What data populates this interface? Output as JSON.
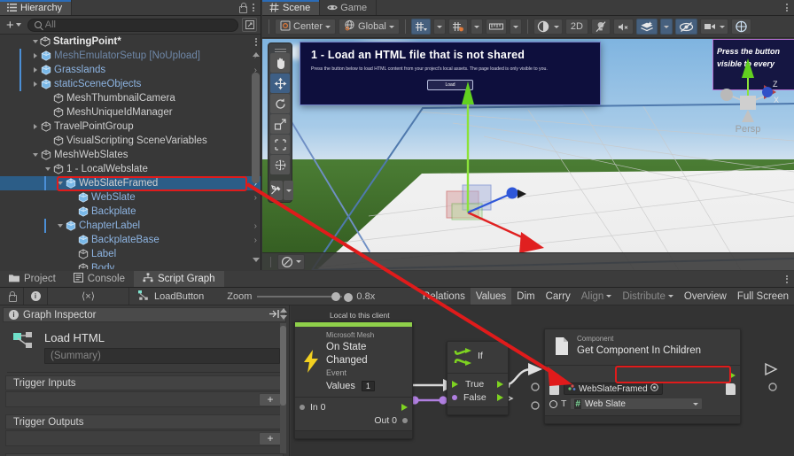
{
  "hierarchy": {
    "tab_label": "Hierarchy",
    "search_placeholder": "All",
    "add_label": "+",
    "scene_name": "StartingPoint*",
    "items": [
      {
        "label": "MeshEmulatorSetup [NoUpload]",
        "indent": 1,
        "twisty": "right",
        "icon": "prefab-cube",
        "color": "dim",
        "chev": true,
        "prefab": true
      },
      {
        "label": "Grasslands",
        "indent": 1,
        "twisty": "right",
        "icon": "prefab-cube",
        "color": "blue",
        "chev": true,
        "prefab": true
      },
      {
        "label": "staticSceneObjects",
        "indent": 1,
        "twisty": "right",
        "icon": "prefab-cube",
        "color": "blue",
        "chev": true,
        "prefab": true
      },
      {
        "label": "MeshThumbnailCamera",
        "indent": 2,
        "twisty": "none",
        "icon": "gameobject",
        "color": "plain",
        "chev": false,
        "prefab": false
      },
      {
        "label": "MeshUniqueIdManager",
        "indent": 2,
        "twisty": "none",
        "icon": "gameobject",
        "color": "plain",
        "chev": false,
        "prefab": false
      },
      {
        "label": "TravelPointGroup",
        "indent": 1,
        "twisty": "right",
        "icon": "gameobject",
        "color": "plain",
        "chev": false,
        "prefab": false
      },
      {
        "label": "VisualScripting SceneVariables",
        "indent": 2,
        "twisty": "none",
        "icon": "gameobject",
        "color": "plain",
        "chev": false,
        "prefab": false
      },
      {
        "label": "MeshWebSlates",
        "indent": 1,
        "twisty": "down",
        "icon": "gameobject",
        "color": "plain",
        "chev": false,
        "prefab": false
      },
      {
        "label": "1 - LocalWebslate",
        "indent": 2,
        "twisty": "down",
        "icon": "gameobject",
        "color": "plain",
        "chev": false,
        "prefab": false
      },
      {
        "label": "WebSlateFramed",
        "indent": 3,
        "twisty": "down",
        "icon": "prefab-cube",
        "color": "plain",
        "chev": true,
        "prefab": true,
        "selected": true,
        "highlight": true
      },
      {
        "label": "WebSlate",
        "indent": 4,
        "twisty": "none",
        "icon": "prefab-cube",
        "color": "blue",
        "chev": true,
        "prefab": false
      },
      {
        "label": "Backplate",
        "indent": 4,
        "twisty": "none",
        "icon": "prefab-cube-variant",
        "color": "blue",
        "chev": false,
        "prefab": false
      },
      {
        "label": "ChapterLabel",
        "indent": 3,
        "twisty": "down",
        "icon": "prefab-cube",
        "color": "blue",
        "chev": true,
        "prefab": true
      },
      {
        "label": "BackplateBase",
        "indent": 4,
        "twisty": "none",
        "icon": "prefab-cube",
        "color": "blue",
        "chev": true,
        "prefab": false
      },
      {
        "label": "Label",
        "indent": 4,
        "twisty": "none",
        "icon": "gameobject",
        "color": "blue",
        "chev": false,
        "prefab": false
      },
      {
        "label": "Body",
        "indent": 4,
        "twisty": "none",
        "icon": "gameobject",
        "color": "blue",
        "chev": false,
        "prefab": false
      }
    ]
  },
  "scene": {
    "tabs": [
      {
        "label": "Scene",
        "icon": "grid-icon",
        "active": true
      },
      {
        "label": "Game",
        "icon": "gamepad-icon",
        "active": false
      }
    ],
    "toolbar": {
      "pivot_mode": "Center",
      "handle_space": "Global",
      "twod_label": "2D",
      "grid_icon": "grid-snap-icon",
      "snap_icon": "snap-increment-icon",
      "ruler_icon": "ruler-icon",
      "shading_icon": "shading-sphere-icon",
      "light_icon": "lighting-icon",
      "audio_icon": "audio-mute-icon",
      "fx_icon": "effects-icon",
      "hidden_icon": "hidden-objects-icon",
      "camera_icon": "scene-camera-icon",
      "gizmos_icon": "gizmos-icon"
    },
    "tools": [
      {
        "name": "hand-tool",
        "glyph": "hand",
        "active": false
      },
      {
        "name": "move-tool",
        "glyph": "move",
        "active": true
      },
      {
        "name": "rotate-tool",
        "glyph": "rotate",
        "active": false
      },
      {
        "name": "scale-tool",
        "glyph": "scale",
        "active": false
      },
      {
        "name": "rect-tool",
        "glyph": "rect",
        "active": false
      },
      {
        "name": "transform-tool",
        "glyph": "transform",
        "active": false
      }
    ],
    "gizmo_label": "Persp",
    "slate_primary": {
      "title": "1 - Load an HTML file that is not shared",
      "body": "Press the button below to load HTML content from your project's local assets. The page loaded is only visible to you.",
      "button": "Load"
    },
    "slate_secondary": {
      "line1": "Press the button",
      "line2": "visible to every"
    }
  },
  "bottom": {
    "tabs": [
      {
        "label": "Project",
        "icon": "folder-icon",
        "active": false
      },
      {
        "label": "Console",
        "icon": "console-icon",
        "active": false
      },
      {
        "label": "Script Graph",
        "icon": "script-graph-icon",
        "active": true
      }
    ],
    "graph_toolbar": {
      "lock_icon": "lock-icon",
      "info_icon": "info-icon",
      "code_icon": "code-brackets-icon",
      "breadcrumb": "LoadButton",
      "zoom_label": "Zoom",
      "zoom_value": "0.8x",
      "right_items": [
        {
          "label": "Relations",
          "state": "normal"
        },
        {
          "label": "Values",
          "state": "active"
        },
        {
          "label": "Dim",
          "state": "normal"
        },
        {
          "label": "Carry",
          "state": "normal"
        },
        {
          "label": "Align",
          "state": "dim",
          "dropdown": true
        },
        {
          "label": "Distribute",
          "state": "dim",
          "dropdown": true
        },
        {
          "label": "Overview",
          "state": "normal"
        },
        {
          "label": "Full Screen",
          "state": "normal"
        }
      ]
    }
  },
  "graph_inspector": {
    "header": "Graph Inspector",
    "graph_name": "Load HTML",
    "summary_placeholder": "(Summary)",
    "sections": [
      {
        "title": "Trigger Inputs",
        "add": "+"
      },
      {
        "title": "Trigger Outputs",
        "add": "+"
      }
    ]
  },
  "graph": {
    "canvas_note": "Local to this client",
    "nodes": [
      {
        "id": "event",
        "vendor": "Microsoft Mesh",
        "title": "On State Changed",
        "subtitle": "Event",
        "values_label": "Values",
        "values_count": "1",
        "ports_in": [
          {
            "label": "In 0"
          }
        ],
        "ports_out": [
          {
            "label": "Out 0"
          }
        ]
      },
      {
        "id": "if",
        "title": "If",
        "ports_out": [
          {
            "label": "True"
          },
          {
            "label": "False"
          }
        ]
      },
      {
        "id": "getcomp",
        "vendor": "Component",
        "title": "Get Component In Children",
        "target_value": "WebSlateFramed",
        "type_label": "T",
        "type_value": "Web Slate"
      }
    ]
  },
  "colors": {
    "accent_selection": "#2c5d87",
    "highlight_red": "#e01b1b",
    "node_green": "#8fd04a",
    "port_green": "#7ed321",
    "link_purple": "#b07fe0",
    "panel_bg": "#383838"
  }
}
